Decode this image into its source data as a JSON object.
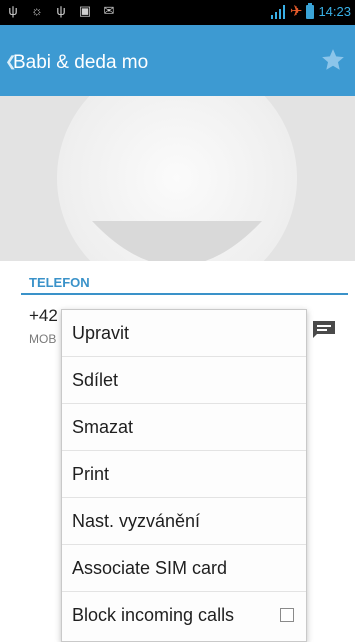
{
  "status_bar": {
    "time": "14:23",
    "left_icons": [
      "usb-icon",
      "android-debug-icon",
      "usb-icon",
      "screenshot-icon",
      "mail-icon"
    ],
    "right_icons": [
      "signal-icon",
      "airplane-icon",
      "battery-icon"
    ],
    "airplane_color": "#e85c2b",
    "battery_color": "#3aa3d6"
  },
  "action_bar": {
    "title": "Babi & deda mo",
    "background_color": "#3d9ad2",
    "star_icon": "star-icon"
  },
  "contact": {
    "section_header": "TELEFON",
    "phone_number": "+42",
    "phone_type": "MOB",
    "action_icon": "message-icon"
  },
  "context_menu": {
    "items": [
      {
        "label": "Upravit"
      },
      {
        "label": "Sdílet"
      },
      {
        "label": "Smazat"
      },
      {
        "label": "Print"
      },
      {
        "label": "Nast. vyzvánění"
      },
      {
        "label": "Associate SIM card"
      },
      {
        "label": "Block incoming calls",
        "checked": false
      }
    ]
  }
}
